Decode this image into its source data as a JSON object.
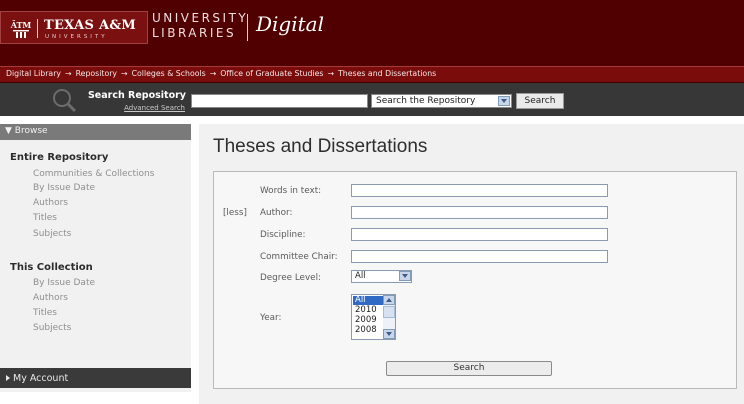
{
  "header": {
    "university_name": "TEXAS A&M",
    "university_sub": "UNIVERSITY",
    "libraries_line1": "UNIVERSITY",
    "libraries_line2": "LIBRARIES",
    "digital": "Digital"
  },
  "breadcrumb": {
    "items": [
      "Digital Library",
      "Repository",
      "Colleges & Schools",
      "Office of Graduate Studies",
      "Theses and Dissertations"
    ],
    "separator": "→"
  },
  "searchbar": {
    "title": "Search Repository",
    "advanced_link": "Advanced Search",
    "query_value": "",
    "scope_selected": "Search the Repository",
    "button_label": "Search"
  },
  "sidebar": {
    "browse_label": "▼ Browse",
    "entire_repository": {
      "heading": "Entire Repository",
      "links": [
        "Communities & Collections",
        "By Issue Date",
        "Authors",
        "Titles",
        "Subjects"
      ]
    },
    "this_collection": {
      "heading": "This Collection",
      "links": [
        "By Issue Date",
        "Authors",
        "Titles",
        "Subjects"
      ]
    },
    "my_account_label": "My Account"
  },
  "main": {
    "title": "Theses and Dissertations",
    "form": {
      "less_link": "[less]",
      "labels": {
        "words": "Words in text:",
        "author": "Author:",
        "discipline": "Discipline:",
        "chair": "Committee Chair:",
        "degree": "Degree Level:",
        "year": "Year:"
      },
      "values": {
        "words": "",
        "author": "",
        "discipline": "",
        "chair": ""
      },
      "degree_selected": "All",
      "year_options": [
        "All",
        "2010",
        "2009",
        "2008"
      ],
      "year_selected": "All",
      "search_button": "Search"
    }
  },
  "colors": {
    "maroon": "#500000",
    "breadcrumb_bg": "#7a0c0c",
    "searchbar_bg": "#373737",
    "panel_bg": "#f1f1f1"
  },
  "icons": {
    "logo": "atm-logo-icon",
    "search": "magnifier-icon",
    "select_arrow": "chevron-down-icon",
    "expand": "triangle-right-icon"
  }
}
